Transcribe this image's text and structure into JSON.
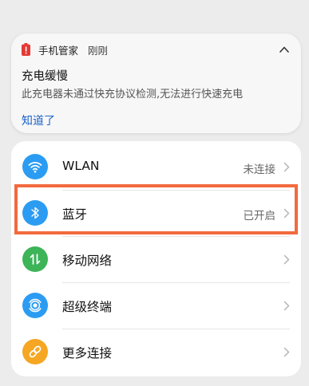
{
  "notification": {
    "app_name": "手机管家",
    "time": "刚刚",
    "title": "充电缓慢",
    "body": "此充电器未通过快充协议检测,无法进行快速充电",
    "action": "知道了",
    "app_icon": "battery-alert-icon",
    "collapse_icon": "chevron-up-icon"
  },
  "settings": {
    "items": [
      {
        "label": "WLAN",
        "status": "未连接",
        "icon": "wifi-icon",
        "color": "#2b9cf2"
      },
      {
        "label": "蓝牙",
        "status": "已开启",
        "icon": "bluetooth-icon",
        "color": "#2b9cf2"
      },
      {
        "label": "移动网络",
        "status": "",
        "icon": "mobile-data-icon",
        "color": "#3cb457"
      },
      {
        "label": "超级终端",
        "status": "",
        "icon": "super-device-icon",
        "color": "#2b9cf2"
      },
      {
        "label": "更多连接",
        "status": "",
        "icon": "link-icon",
        "color": "#f5a623"
      }
    ]
  },
  "colors": {
    "highlight": "#f26a3e",
    "link": "#1a62c9",
    "battery_alert": "#e53935"
  }
}
